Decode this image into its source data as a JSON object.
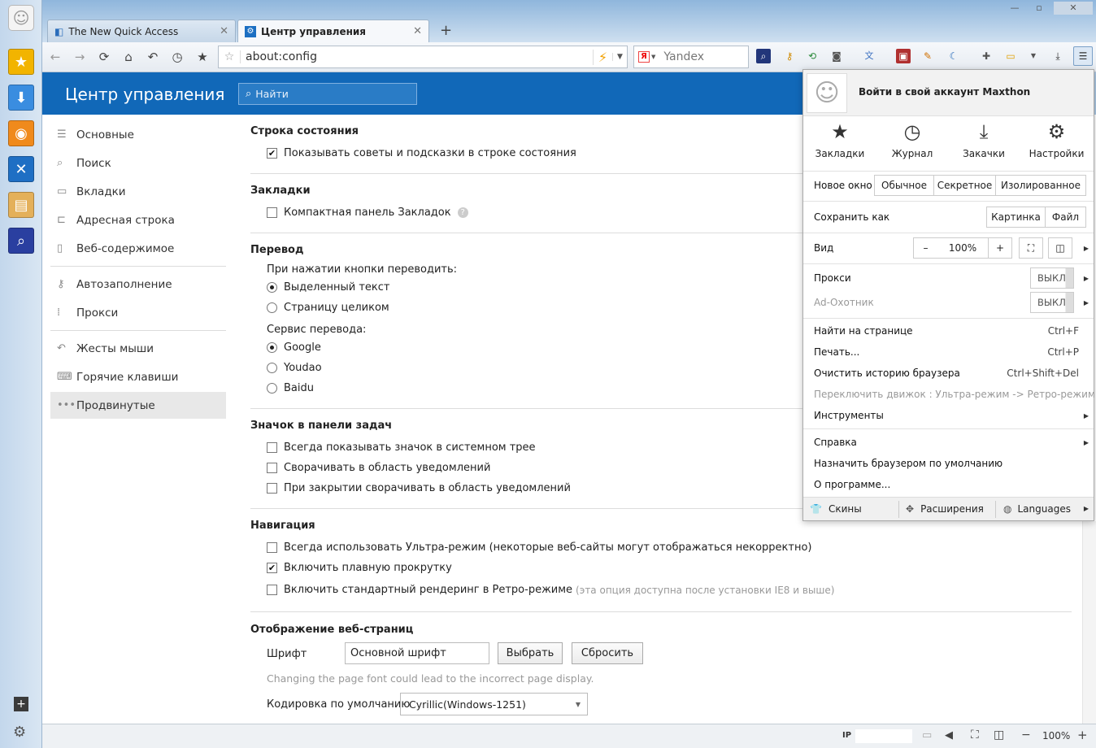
{
  "tabs": [
    {
      "label": "The New Quick Access"
    },
    {
      "label": "Центр управления"
    }
  ],
  "address": {
    "url": "about:config"
  },
  "search": {
    "engine": "Yandex"
  },
  "header": {
    "title": "Центр управления",
    "search_placeholder": "Найти"
  },
  "nav": {
    "group1": [
      "Основные",
      "Поиск",
      "Вкладки",
      "Адресная строка",
      "Веб-содержимое"
    ],
    "group2": [
      "Автозаполнение",
      "Прокси"
    ],
    "group3": [
      "Жесты мыши",
      "Горячие клавиши",
      "Продвинутые"
    ]
  },
  "status_bar_section": {
    "title": "Строка состояния",
    "opt1": "Показывать советы и подсказки в строке состояния"
  },
  "bookmarks_section": {
    "title": "Закладки",
    "opt1": "Компактная панель Закладок"
  },
  "translate_section": {
    "title": "Перевод",
    "q1": "При нажатии кнопки переводить:",
    "a1": "Выделенный текст",
    "a2": "Страницу целиком",
    "q2": "Сервис перевода:",
    "s1": "Google",
    "s2": "Youdao",
    "s3": "Baidu"
  },
  "taskbar_section": {
    "title": "Значок в панели задач",
    "o1": "Всегда показывать значок в системном трее",
    "o2": "Сворачивать в область уведомлений",
    "o3": "При закрытии сворачивать в область уведомлений"
  },
  "navigation_section": {
    "title": "Навигация",
    "o1": "Всегда использовать Ультра-режим (некоторые веб-сайты могут отображаться некорректно)",
    "o2": "Включить плавную прокрутку",
    "o3": "Включить стандартный рендеринг в Ретро-режиме",
    "o3_hint": "(эта опция доступна после установки IE8 и выше)"
  },
  "web_display_section": {
    "title": "Отображение веб-страниц",
    "font_label": "Шрифт",
    "font_value": "Основной шрифт",
    "choose_btn": "Выбрать",
    "reset_btn": "Сбросить",
    "font_hint": "Changing the page font could lead to the incorrect page display.",
    "encoding_label": "Кодировка по умолчанию",
    "encoding_value": "Cyrillic(Windows-1251)"
  },
  "menu": {
    "account": "Войти в свой аккаунт Maxthon",
    "quick": [
      "Закладки",
      "Журнал",
      "Закачки",
      "Настройки"
    ],
    "new_window_label": "Новое окно",
    "new_window_opts": [
      "Обычное",
      "Секретное",
      "Изолированное"
    ],
    "save_as_label": "Сохранить как",
    "save_as_opts": [
      "Картинка",
      "Файл"
    ],
    "view_label": "Вид",
    "zoom_minus": "–",
    "zoom": "100%",
    "zoom_plus": "+",
    "proxy_label": "Прокси",
    "proxy_state": "ВЫКЛ",
    "adhunter_label": "Ad-Охотник",
    "adhunter_state": "ВЫКЛ",
    "find": "Найти на странице",
    "find_key": "Ctrl+F",
    "print": "Печать...",
    "print_key": "Ctrl+P",
    "clear": "Очистить историю браузера",
    "clear_key": "Ctrl+Shift+Del",
    "switch_engine": "Переключить движок : Ультра-режим -> Ретро-режим",
    "tools": "Инструменты",
    "help": "Справка",
    "set_default": "Назначить браузером по умолчанию",
    "about": "О программе...",
    "skins": "Скины",
    "extensions": "Расширения",
    "languages": "Languages"
  },
  "statusbar": {
    "ip_label": "IP",
    "zoom": "100%"
  },
  "colors": {
    "header_blue": "#1168b8",
    "accent": "#1168b8"
  }
}
